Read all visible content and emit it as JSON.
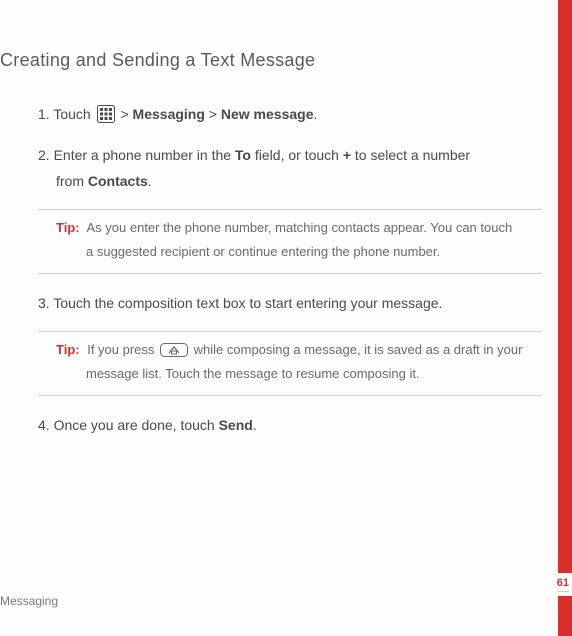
{
  "heading": "Creating and Sending a Text Message",
  "steps": {
    "s1": {
      "num": "1.",
      "pre": " Touch ",
      "sep1": " > ",
      "bold1": "Messaging",
      "sep2": " > ",
      "bold2": "New message",
      "end": "."
    },
    "s2": {
      "num": "2.",
      "pre": " Enter a phone number in the ",
      "bold1": "To",
      "mid": " field, or touch ",
      "bold2": "+",
      "mid2": " to select a number",
      "cont_pre": "from ",
      "bold3": "Contacts",
      "end": "."
    },
    "tip1": {
      "label": "Tip:",
      "line1": "As you enter the phone number, matching contacts appear. You can touch",
      "line2": "a suggested recipient or continue entering the phone number."
    },
    "s3": {
      "num": "3.",
      "text": " Touch the composition text box to start entering your message."
    },
    "tip2": {
      "label": "Tip:",
      "pre": "If you press ",
      "mid": " while composing a message, it is saved as a draft in your",
      "line2": "message list. Touch the message to resume composing it."
    },
    "s4": {
      "num": "4.",
      "pre": " Once you are done, touch ",
      "bold1": "Send",
      "end": "."
    }
  },
  "footer": "Messaging",
  "pageNumber": "61"
}
